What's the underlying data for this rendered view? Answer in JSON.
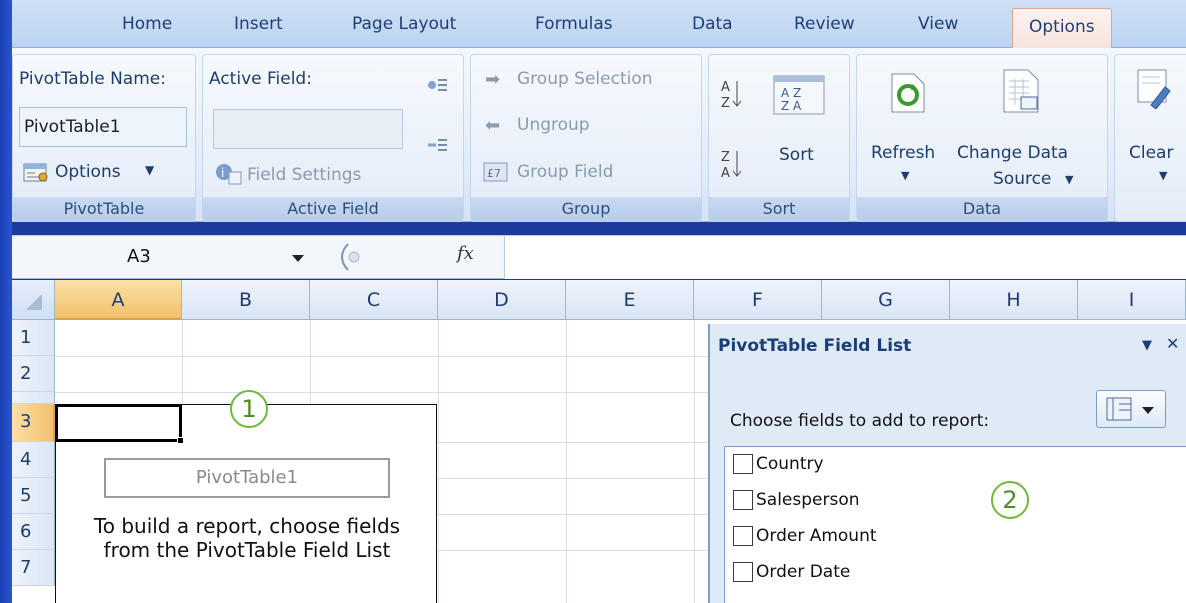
{
  "ribbon_tabs": [
    "Home",
    "Insert",
    "Page Layout",
    "Formulas",
    "Data",
    "Review",
    "View",
    "Options"
  ],
  "active_tab": "Options",
  "groups": {
    "pivottable": {
      "label": "PivotTable",
      "name_label": "PivotTable Name:",
      "name_value": "PivotTable1",
      "options_label": "Options"
    },
    "active_field": {
      "label": "Active Field",
      "field_label": "Active Field:",
      "field_settings_label": "Field Settings"
    },
    "group": {
      "label": "Group",
      "group_selection": "Group Selection",
      "ungroup": "Ungroup",
      "group_field": "Group Field"
    },
    "sort": {
      "label": "Sort",
      "sort_button": "Sort"
    },
    "data": {
      "label": "Data",
      "refresh": "Refresh",
      "change_data_line1": "Change Data",
      "change_data_line2": "Source"
    },
    "clear": {
      "label": "Clear"
    }
  },
  "formula_bar": {
    "name_box": "A3",
    "fx": "fx",
    "formula": ""
  },
  "columns": [
    "A",
    "B",
    "C",
    "D",
    "E",
    "F",
    "G",
    "H",
    "I"
  ],
  "rows": [
    "1",
    "2",
    "3",
    "4",
    "5",
    "6",
    "7"
  ],
  "selected_cell": "A3",
  "pivot_placeholder": {
    "name": "PivotTable1",
    "hint": "To build a report, choose fields from the PivotTable Field List"
  },
  "callouts": [
    "1",
    "2"
  ],
  "field_list": {
    "title": "PivotTable Field List",
    "choose_label": "Choose fields to add to report:",
    "fields": [
      "Country",
      "Salesperson",
      "Order Amount",
      "Order Date"
    ]
  }
}
